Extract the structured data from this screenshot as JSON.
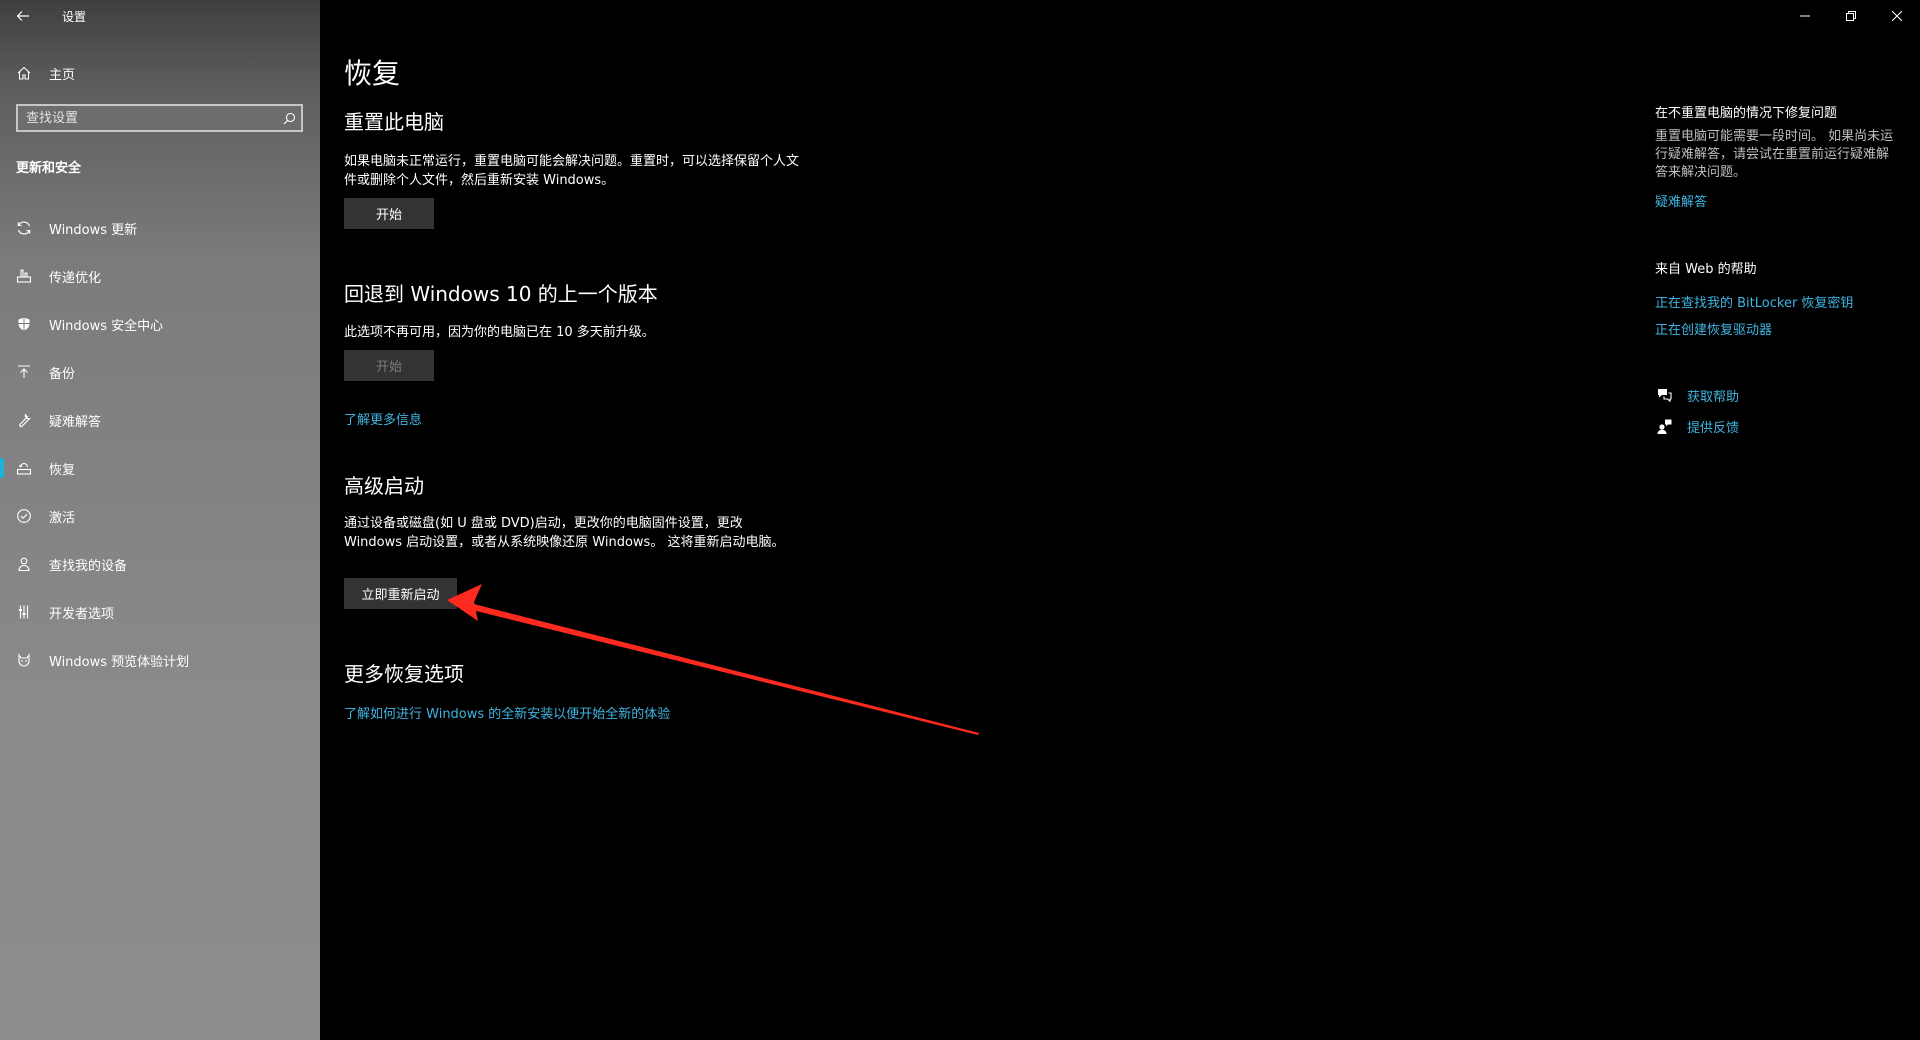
{
  "titlebar": {
    "back_icon": "arrow-left-icon",
    "app_title": "设置",
    "minimize_icon": "minimize-icon",
    "restore_icon": "restore-icon",
    "close_icon": "close-icon"
  },
  "sidebar": {
    "home_label": "主页",
    "search_placeholder": "查找设置",
    "section_title": "更新和安全",
    "items": [
      {
        "label": "Windows 更新",
        "icon": "sync-icon"
      },
      {
        "label": "传递优化",
        "icon": "delivery-optimization-icon"
      },
      {
        "label": "Windows 安全中心",
        "icon": "shield-icon"
      },
      {
        "label": "备份",
        "icon": "backup-arrow-icon"
      },
      {
        "label": "疑难解答",
        "icon": "wrench-icon"
      },
      {
        "label": "恢复",
        "icon": "recovery-icon",
        "active": true
      },
      {
        "label": "激活",
        "icon": "check-circle-icon"
      },
      {
        "label": "查找我的设备",
        "icon": "person-locate-icon"
      },
      {
        "label": "开发者选项",
        "icon": "developer-icon"
      },
      {
        "label": "Windows 预览体验计划",
        "icon": "insider-cat-icon"
      }
    ],
    "accent_color": "#1fb1d6"
  },
  "main": {
    "page_title": "恢复",
    "reset": {
      "heading": "重置此电脑",
      "description": "如果电脑未正常运行，重置电脑可能会解决问题。重置时，可以选择保留个人文件或删除个人文件，然后重新安装 Windows。",
      "button": "开始"
    },
    "rollback": {
      "heading": "回退到 Windows 10 的上一个版本",
      "description": "此选项不再可用，因为你的电脑已在 10 多天前升级。",
      "button": "开始",
      "link": "了解更多信息"
    },
    "advanced": {
      "heading": "高级启动",
      "description": "通过设备或磁盘(如 U 盘或 DVD)启动，更改你的电脑固件设置，更改 Windows 启动设置，或者从系统映像还原 Windows。 这将重新启动电脑。",
      "button": "立即重新启动"
    },
    "more": {
      "heading": "更多恢复选项",
      "link": "了解如何进行 Windows 的全新安装以便开始全新的体验"
    },
    "link_color": "#40b4e0"
  },
  "aside": {
    "fix_heading": "在不重置电脑的情况下修复问题",
    "fix_description": "重置电脑可能需要一段时间。 如果尚未运行疑难解答，请尝试在重置前运行疑难解答来解决问题。",
    "fix_link": "疑难解答",
    "web_heading": "来自 Web 的帮助",
    "web_links": [
      "正在查找我的 BitLocker 恢复密钥",
      "正在创建恢复驱动器"
    ],
    "get_help": "获取帮助",
    "feedback": "提供反馈"
  },
  "annotation": {
    "color": "#ff2a1f"
  }
}
